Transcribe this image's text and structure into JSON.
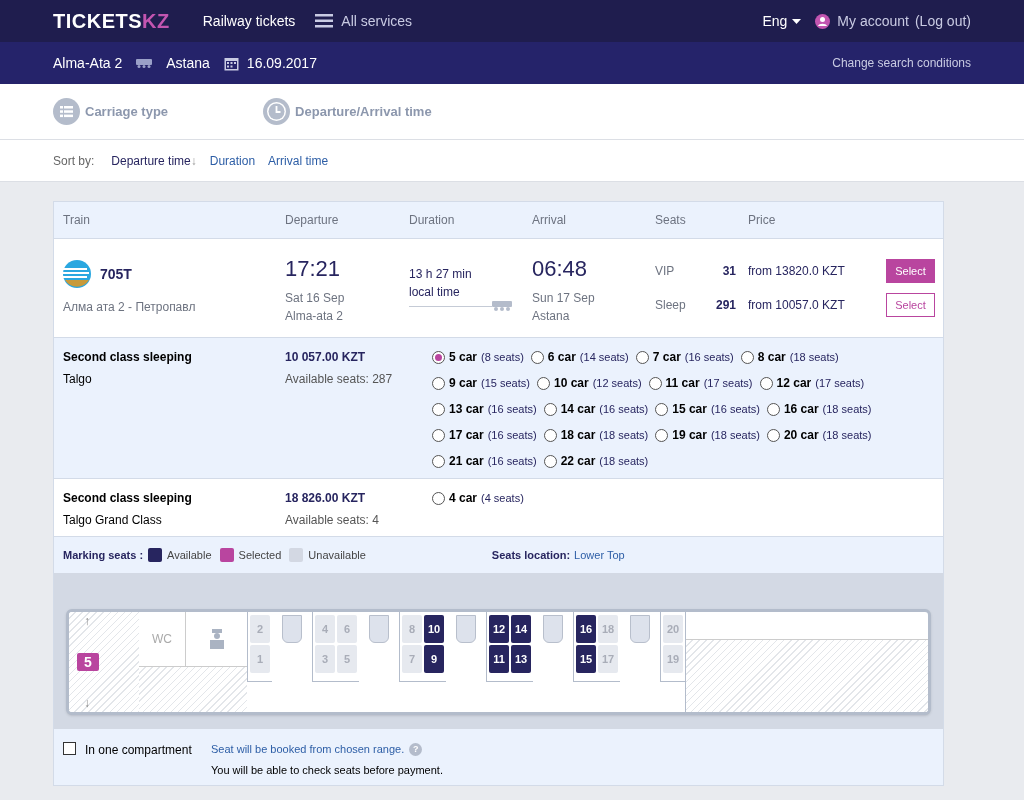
{
  "header": {
    "logo": "TICKETS",
    "logo_accent": "KZ",
    "nav": [
      "Railway tickets",
      "All services"
    ],
    "language": "Eng",
    "account": "My account",
    "logout": "(Log out)"
  },
  "route": {
    "from": "Alma-Ata 2",
    "to": "Astana",
    "date": "16.09.2017",
    "change": "Change search conditions"
  },
  "filters": [
    "Carriage type",
    "Departure/Arrival time"
  ],
  "sort": {
    "label": "Sort by:",
    "options": [
      {
        "label": "Departure time",
        "arrow": "↓",
        "selected": true
      },
      {
        "label": "Duration",
        "selected": false
      },
      {
        "label": "Arrival time",
        "selected": false
      }
    ]
  },
  "table": {
    "columns": [
      "Train",
      "Departure",
      "Duration",
      "Arrival",
      "Seats",
      "Price"
    ],
    "train": {
      "number": "705T",
      "route": "Алма ата 2 - Петропавл",
      "departure": {
        "time": "17:21",
        "date": "Sat 16 Sep",
        "station": "Alma-ata 2"
      },
      "duration": "13 h 27 min",
      "duration_note": "local time",
      "arrival": {
        "time": "06:48",
        "date": "Sun 17 Sep",
        "station": "Astana"
      },
      "classes": [
        {
          "name": "VIP",
          "count": "31",
          "price": "from 13820.0 KZT",
          "button": "Select",
          "selected": true
        },
        {
          "name": "Sleep",
          "count": "291",
          "price": "from 10057.0 KZT",
          "button": "Select",
          "selected": false
        }
      ]
    }
  },
  "carriages": [
    {
      "name": "Second class sleeping",
      "subtitle": "Talgo",
      "price": "10 057.00 KZT",
      "available": "Available seats: 287",
      "expanded": true,
      "cars": [
        {
          "label": "5 car",
          "seats": "(8 seats)",
          "selected": true
        },
        {
          "label": "6 car",
          "seats": "(14 seats)",
          "selected": false
        },
        {
          "label": "7 car",
          "seats": "(16 seats)",
          "selected": false
        },
        {
          "label": "8 car",
          "seats": "(18 seats)",
          "selected": false
        },
        {
          "label": "9 car",
          "seats": "(15 seats)",
          "selected": false
        },
        {
          "label": "10 car",
          "seats": "(12 seats)",
          "selected": false
        },
        {
          "label": "11 car",
          "seats": "(17 seats)",
          "selected": false
        },
        {
          "label": "12 car",
          "seats": "(17 seats)",
          "selected": false
        },
        {
          "label": "13 car",
          "seats": "(16 seats)",
          "selected": false
        },
        {
          "label": "14 car",
          "seats": "(16 seats)",
          "selected": false
        },
        {
          "label": "15 car",
          "seats": "(16 seats)",
          "selected": false
        },
        {
          "label": "16 car",
          "seats": "(18 seats)",
          "selected": false
        },
        {
          "label": "17 car",
          "seats": "(16 seats)",
          "selected": false
        },
        {
          "label": "18 car",
          "seats": "(18 seats)",
          "selected": false
        },
        {
          "label": "19 car",
          "seats": "(18 seats)",
          "selected": false
        },
        {
          "label": "20 car",
          "seats": "(18 seats)",
          "selected": false
        },
        {
          "label": "21 car",
          "seats": "(16 seats)",
          "selected": false
        },
        {
          "label": "22 car",
          "seats": "(18 seats)",
          "selected": false
        }
      ]
    },
    {
      "name": "Second class sleeping",
      "subtitle": "Talgo Grand Class",
      "price": "18 826.00 KZT",
      "available": "Available seats: 4",
      "expanded": false,
      "cars": [
        {
          "label": "4 car",
          "seats": "(4 seats)",
          "selected": false
        }
      ]
    }
  ],
  "legend": {
    "title": "Marking seats :",
    "items": [
      {
        "label": "Available",
        "color": "#27255f"
      },
      {
        "label": "Selected",
        "color": "#b9459f"
      },
      {
        "label": "Unavailable",
        "color": "#d3d8e3"
      }
    ],
    "location_label": "Seats location:",
    "location_value": "Lower Top"
  },
  "seat_map": {
    "car_number": "5",
    "wc": "WC",
    "arrow_up": "↑",
    "arrow_down": "↓",
    "groups": [
      [
        {
          "top": {
            "number": "2",
            "available": false
          },
          "bottom": {
            "number": "1",
            "available": false
          }
        }
      ],
      [
        {
          "top": {
            "number": "4",
            "available": false
          },
          "bottom": {
            "number": "3",
            "available": false
          }
        },
        {
          "top": {
            "number": "6",
            "available": false
          },
          "bottom": {
            "number": "5",
            "available": false
          }
        }
      ],
      [
        {
          "top": {
            "number": "8",
            "available": false
          },
          "bottom": {
            "number": "7",
            "available": false
          }
        },
        {
          "top": {
            "number": "10",
            "available": true
          },
          "bottom": {
            "number": "9",
            "available": true
          }
        }
      ],
      [
        {
          "top": {
            "number": "12",
            "available": true
          },
          "bottom": {
            "number": "11",
            "available": true
          }
        },
        {
          "top": {
            "number": "14",
            "available": true
          },
          "bottom": {
            "number": "13",
            "available": true
          }
        }
      ],
      [
        {
          "top": {
            "number": "16",
            "available": true
          },
          "bottom": {
            "number": "15",
            "available": true
          }
        },
        {
          "top": {
            "number": "18",
            "available": false
          },
          "bottom": {
            "number": "17",
            "available": false
          }
        }
      ],
      [
        {
          "top": {
            "number": "20",
            "available": false
          },
          "bottom": {
            "number": "19",
            "available": false
          }
        }
      ]
    ]
  },
  "options": {
    "compartment_label": "In one compartment",
    "compartment_checked": false,
    "note": "Seat will be booked from chosen range.",
    "help": "?",
    "note2": "You will be able to check seats before payment."
  }
}
